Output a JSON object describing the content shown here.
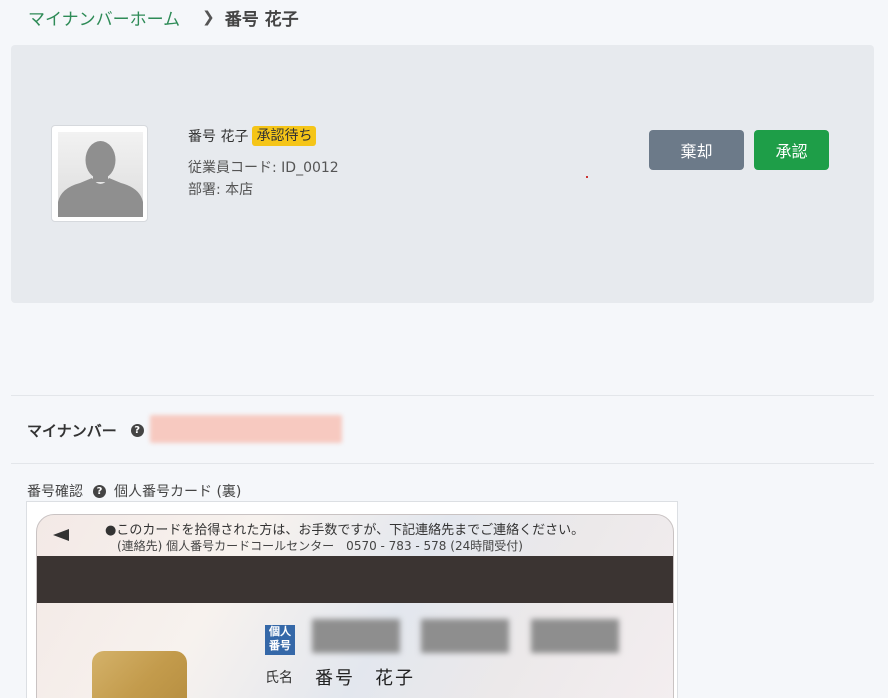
{
  "breadcrumb": {
    "home": "マイナンバーホーム",
    "separator": "❯",
    "current": "番号 花子"
  },
  "profile": {
    "name": "番号 花子",
    "status_badge": "承認待ち",
    "employee_code": "従業員コード: ID_0012",
    "department": "部署: 本店",
    "buttons": {
      "discard": "棄却",
      "approve": "承認"
    }
  },
  "mynumber": {
    "label": "マイナンバー",
    "help_icon": "?"
  },
  "verification": {
    "label": "番号確認",
    "help_icon": "?",
    "document_type": "個人番号カード (裏)"
  },
  "card_image": {
    "notice_line1": "●このカードを拾得された方は、お手数ですが、下記連絡先までご連絡ください。",
    "notice_line2": "(連絡先) 個人番号カードコールセンター　0570 - 783 - 578 (24時間受付)",
    "kanji_label": "個人番号",
    "name_label": "氏名",
    "name_value": "番号　花子"
  },
  "colors": {
    "breadcrumb_link": "#2e8b57",
    "badge": "#f5c518",
    "discard_button": "#6c7a89",
    "approve_button": "#1e9e48"
  }
}
